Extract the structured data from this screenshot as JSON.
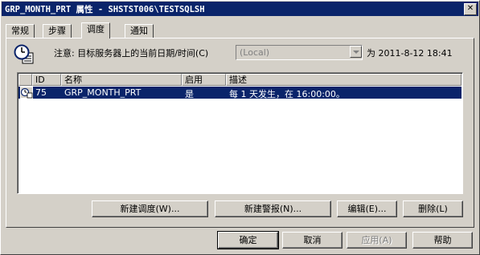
{
  "window": {
    "title": "GRP_MONTH_PRT 属性 - SHSTST006\\TESTSQLSH",
    "close_label": "✕"
  },
  "tabs": [
    {
      "label": "常规"
    },
    {
      "label": "步骤"
    },
    {
      "label": "调度"
    },
    {
      "label": "通知"
    }
  ],
  "active_tab": "调度",
  "schedule": {
    "note_label": "注意: 目标服务器上的当前日期/时间(C)",
    "server_combo_value": "(Local)",
    "current_datetime": "为 2011-8-12 18:41"
  },
  "list": {
    "columns": [
      "ID",
      "名称",
      "启用",
      "描述"
    ],
    "rows": [
      {
        "id": "75",
        "name": "GRP_MONTH_PRT",
        "enabled": "是",
        "description": "每 1 天发生，在 16:00:00。"
      }
    ]
  },
  "action_buttons": {
    "new_schedule": "新建调度(W)...",
    "new_alert": "新建警报(N)...",
    "edit": "编辑(E)...",
    "delete": "删除(L)"
  },
  "dialog_buttons": {
    "ok": "确定",
    "cancel": "取消",
    "apply": "应用(A)",
    "help": "帮助"
  },
  "colors": {
    "title_bar": "#0a246a",
    "selection": "#0a246a",
    "face": "#d4d0c8"
  },
  "icons": {
    "schedule": "clock-calendar-icon",
    "job_row": "job-schedule-icon"
  }
}
